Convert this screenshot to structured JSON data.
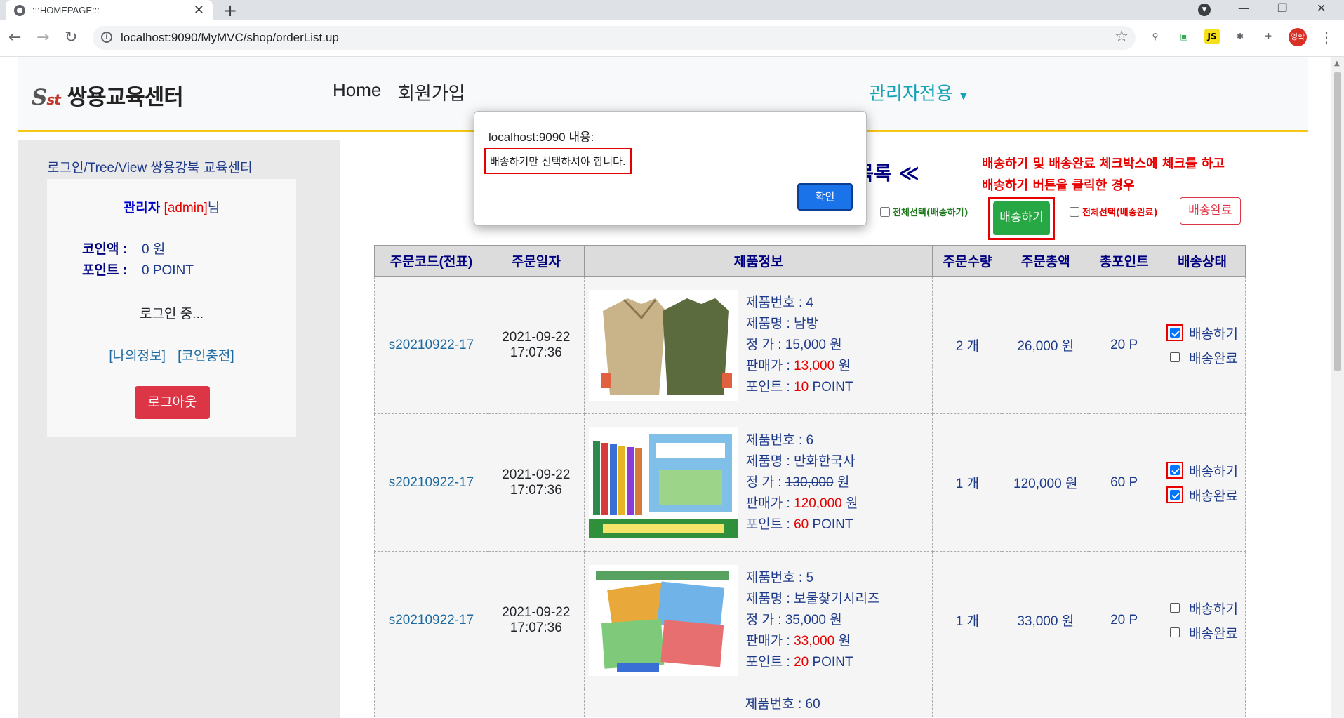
{
  "browser": {
    "tab_title": ":::HOMEPAGE:::",
    "url": "localhost:9090/MyMVC/shop/orderList.up",
    "profile_initial": "영학"
  },
  "header": {
    "logo_text": "쌍용교육센터",
    "menu": {
      "home": "Home",
      "signup": "회원가입",
      "admin": "관리자전용"
    }
  },
  "sidebar": {
    "title": "로그인/Tree/View  쌍용강북 교육센터",
    "user_role": "관리자",
    "user_id": "[admin]",
    "user_suffix": "님",
    "coin_label": "코인액 :",
    "coin_value": "0 원",
    "point_label": "포인트 :",
    "point_value": "0 POINT",
    "status": "로그인 중...",
    "link_myinfo": "[나의정보]",
    "link_coin": "[코인충전]",
    "logout": "로그아웃"
  },
  "content": {
    "title": "≫ 주문내역 전체목록 ≪",
    "note_line1": "배송하기 및 배송완료 체크박스에 체크를 하고",
    "note_line2": "배송하기 버튼을 클릭한 경우",
    "select_all_ship": "전체선택(배송하기)",
    "ship_button": "배송하기",
    "select_all_done": "전체선택(배송완료)",
    "done_button": "배송완료"
  },
  "table": {
    "headers": [
      "주문코드(전표)",
      "주문일자",
      "제품정보",
      "주문수량",
      "주문총액",
      "총포인트",
      "배송상태"
    ],
    "rows": [
      {
        "code": "s20210922-17",
        "date": "2021-09-22",
        "time": "17:07:36",
        "pnum": "제품번호 : 4",
        "pname": "제품명 : 남방",
        "price_label": "정 가 :",
        "price": "15,000",
        "sale_label": "판매가 :",
        "sale": "13,000",
        "point_label": "포인트 :",
        "point": "10",
        "qty": "2 개",
        "total": "26,000 원",
        "tpoint": "20 P",
        "ship": true,
        "done": false
      },
      {
        "code": "s20210922-17",
        "date": "2021-09-22",
        "time": "17:07:36",
        "pnum": "제품번호 : 6",
        "pname": "제품명 : 만화한국사",
        "price_label": "정 가 :",
        "price": "130,000",
        "sale_label": "판매가 :",
        "sale": "120,000",
        "point_label": "포인트 :",
        "point": "60",
        "qty": "1 개",
        "total": "120,000 원",
        "tpoint": "60 P",
        "ship": true,
        "done": true
      },
      {
        "code": "s20210922-17",
        "date": "2021-09-22",
        "time": "17:07:36",
        "pnum": "제품번호 : 5",
        "pname": "제품명 : 보물찾기시리즈",
        "price_label": "정 가 :",
        "price": "35,000",
        "sale_label": "판매가 :",
        "sale": "33,000",
        "point_label": "포인트 :",
        "point": "20",
        "qty": "1 개",
        "total": "33,000 원",
        "tpoint": "20 P",
        "ship": false,
        "done": false
      }
    ],
    "partial_row": {
      "pnum": "제품번호 : 60"
    },
    "won": "원",
    "point_unit": "POINT",
    "ship_label": "배송하기",
    "done_label": "배송완료"
  },
  "dialog": {
    "title": "localhost:9090 내용:",
    "message": "배송하기만 선택하셔야 합니다.",
    "ok": "확인"
  }
}
